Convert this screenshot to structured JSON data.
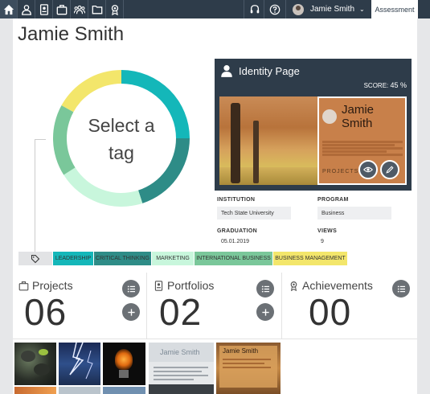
{
  "nav": {
    "icons": [
      "home-icon",
      "profile-icon",
      "identity-icon",
      "projects-icon",
      "groups-icon",
      "folder-icon",
      "achievements-icon"
    ],
    "help_icons": [
      "support-icon",
      "help-icon"
    ],
    "user_name": "Jamie Smith",
    "assessment_tab": "Assessment"
  },
  "page": {
    "title": "Jamie Smith"
  },
  "donut": {
    "label_line1": "Select a",
    "label_line2": "tag",
    "segments": [
      {
        "color": "#14b7b9",
        "value": 0.25
      },
      {
        "color": "#2e8c87",
        "value": 0.2
      },
      {
        "color": "#c8f6dc",
        "value": 0.21
      },
      {
        "color": "#7ac79a",
        "value": 0.17
      },
      {
        "color": "#f3e66b",
        "value": 0.17
      }
    ]
  },
  "identity": {
    "title": "Identity Page",
    "score_label": "SCORE:",
    "score_value": "45 %",
    "card_name_line1": "Jamie",
    "card_name_line2": "Smith",
    "card_section": "PROJECTS"
  },
  "details": {
    "institution_label": "INSTITUTION",
    "institution_value": "Tech State University",
    "program_label": "PROGRAM",
    "program_value": "Business",
    "graduation_label": "GRADUATION",
    "graduation_value": "05.01.2019",
    "views_label": "VIEWS",
    "views_value": "9"
  },
  "tags": [
    {
      "label": "LEADERSHIP",
      "color": "#14b7b9"
    },
    {
      "label": "CRITICAL THINKING",
      "color": "#2e8c87"
    },
    {
      "label": "MARKETING",
      "color": "#c8f6dc"
    },
    {
      "label": "INTERNATIONAL BUSINESS",
      "color": "#7ac79a"
    },
    {
      "label": "BUSINESS MANAGEMENT",
      "color": "#f3e66b"
    }
  ],
  "stats": {
    "projects_label": "Projects",
    "projects_count": "06",
    "portfolios_label": "Portfolios",
    "portfolios_count": "02",
    "achievements_label": "Achievements",
    "achievements_count": "00"
  },
  "portfolio_thumbs": {
    "name_1": "Jamie Smith",
    "name_2": "Jamie Smith"
  }
}
